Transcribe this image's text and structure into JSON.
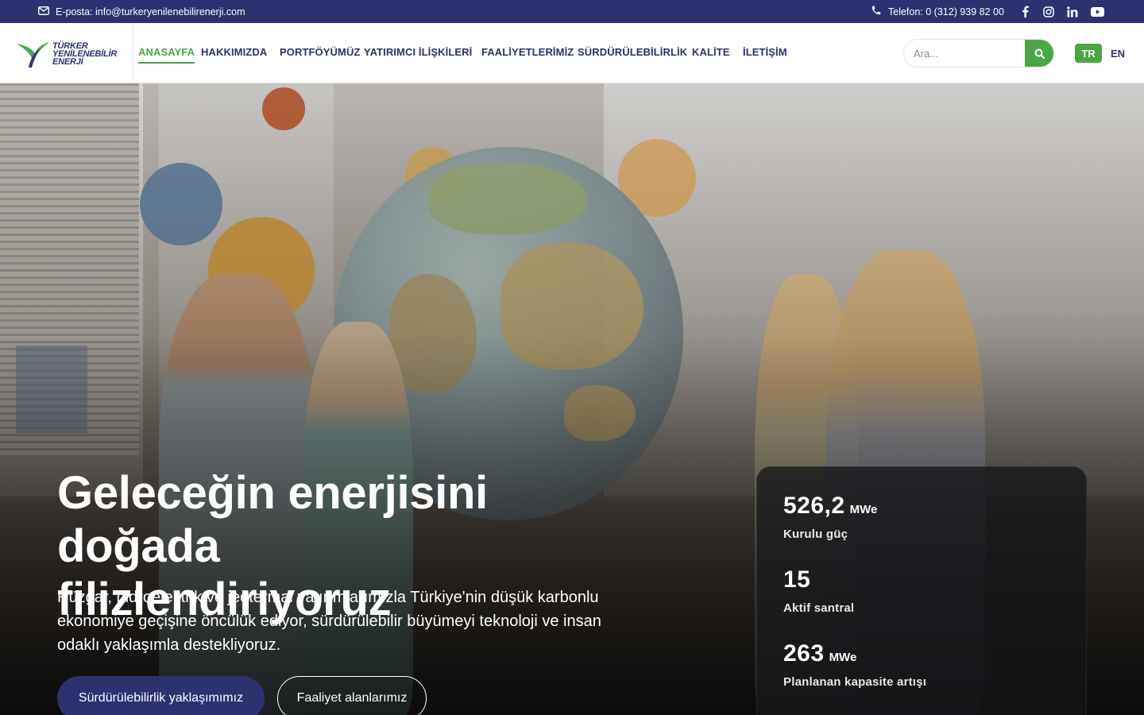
{
  "topbar": {
    "email": "E-posta: info@turkeryenilenebilirenerji.com",
    "phone": "Telefon: 0 (312) 939 82 00",
    "social_icons": [
      "facebook-icon",
      "instagram-icon",
      "linkedin-icon",
      "youtube-icon"
    ]
  },
  "logo": {
    "line1": "TÜRKER",
    "line2": "YENİLENEBİLİR",
    "line3": "ENERJİ"
  },
  "nav": {
    "items": [
      {
        "label": "ANASAYFA",
        "active": true
      },
      {
        "label": "HAKKIMIZDA",
        "active": false
      },
      {
        "label": "PORTFÖYÜMÜZ",
        "active": false
      },
      {
        "label": "YATIRIMCI İLİŞKİLERİ",
        "active": false
      },
      {
        "label": "FAALİYETLERİMİZ",
        "active": false
      },
      {
        "label": "SÜRDÜRÜLEBİLİRLİK",
        "active": false
      },
      {
        "label": "KALİTE",
        "active": false
      },
      {
        "label": "İLETİŞİM",
        "active": false
      }
    ]
  },
  "search": {
    "placeholder": "Ara...",
    "value": ""
  },
  "languages": {
    "tr": "TR",
    "en": "EN",
    "selected": "TR"
  },
  "hero": {
    "title_line1": "Geleceğin enerjisini doğada",
    "title_line2": "filizlendiriyoruz",
    "subtitle_line1": "Rüzgar, hidroelektrik ve jeotermal yatırımlarımızla Türkiye'nin düşük karbonlu",
    "subtitle_line2": "ekonomiye geçişine öncülük ediyor, sürdürülebilir büyümeyi teknoloji ve insan",
    "subtitle_line3": "odaklı yaklaşımla destekliyoruz.",
    "primary_button": "Sürdürülebilirlik yaklaşımımız",
    "secondary_button": "Faaliyet alanlarımız"
  },
  "stats": [
    {
      "value": "526,2",
      "unit": "MWe",
      "label": "Kurulu güç"
    },
    {
      "value": "15",
      "unit": "",
      "label": "Aktif santral"
    },
    {
      "value": "263",
      "unit": "MWe",
      "label": "Planlanan kapasite artışı"
    }
  ],
  "colors": {
    "brand_navy": "#2c3170",
    "brand_green": "#4ba646"
  }
}
